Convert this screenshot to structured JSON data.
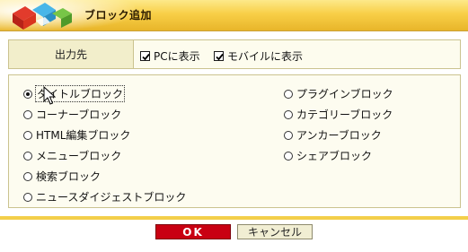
{
  "dialog": {
    "title": "ブロック追加",
    "icon": "colored-blocks-icon"
  },
  "destination": {
    "label": "出力先",
    "options": [
      {
        "label": "PCに表示",
        "checked": true
      },
      {
        "label": "モバイルに表示",
        "checked": true
      }
    ]
  },
  "blocks": {
    "left": [
      {
        "label": "タイトルブロック",
        "selected": true
      },
      {
        "label": "コーナーブロック",
        "selected": false
      },
      {
        "label": "HTML編集ブロック",
        "selected": false
      },
      {
        "label": "メニューブロック",
        "selected": false
      },
      {
        "label": "検索ブロック",
        "selected": false
      },
      {
        "label": "ニュースダイジェストブロック",
        "selected": false
      }
    ],
    "right": [
      {
        "label": "プラグインブロック",
        "selected": false
      },
      {
        "label": "カテゴリーブロック",
        "selected": false
      },
      {
        "label": "アンカーブロック",
        "selected": false
      },
      {
        "label": "シェアブロック",
        "selected": false
      }
    ]
  },
  "buttons": {
    "ok_label": "OK",
    "cancel_label": "キャンセル"
  },
  "colors": {
    "header": "#f8cf47",
    "ok": "#c90012",
    "panel_border": "#cbc38f"
  }
}
